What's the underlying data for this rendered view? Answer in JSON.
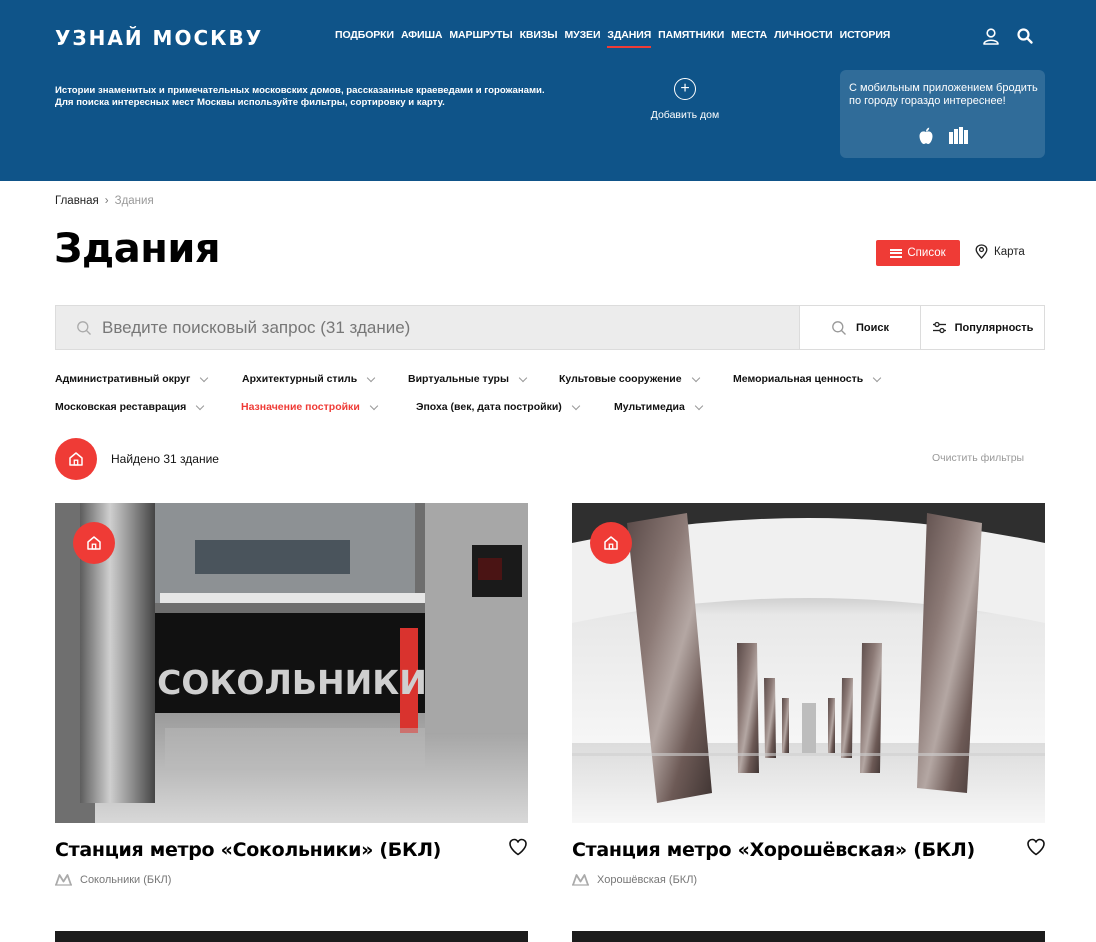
{
  "header": {
    "logo": "УЗНАЙ МОСКВУ",
    "nav": [
      "ПОДБОРКИ",
      "АФИША",
      "МАРШРУТЫ",
      "КВИЗЫ",
      "МУЗЕИ",
      "ЗДАНИЯ",
      "ПАМЯТНИКИ",
      "МЕСТА",
      "ЛИЧНОСТИ",
      "ИСТОРИЯ"
    ],
    "active_nav": "ЗДАНИЯ",
    "description_line1": "Истории знаменитых и примечательных московских домов, рассказанные краеведами и горожанами.",
    "description_line2": "Для поиска интересных мест Москвы используйте фильтры, сортировку и карту.",
    "add_home_label": "Добавить дом",
    "app_promo": "С мобильным приложением бродить по городу гораздо интереснее!",
    "icons": [
      "user-icon",
      "search-icon",
      "apple-icon",
      "app-store-icon",
      "add-icon"
    ]
  },
  "breadcrumb": {
    "home": "Главная",
    "current": "Здания"
  },
  "page_title": "Здания",
  "view_toggle": {
    "list": "Список",
    "map": "Карта"
  },
  "search": {
    "placeholder": "Введите поисковый запрос (31 здание)",
    "button": "Поиск",
    "sort": "Популярность"
  },
  "filters": [
    "Административный округ",
    "Архитектурный стиль",
    "Виртуальные туры",
    "Культовые сооружение",
    "Мемориальная ценность",
    "Московская реставрация",
    "Назначение постройки",
    "Эпоха (век, дата постройки)",
    "Мультимедиа"
  ],
  "active_filter": "Назначение постройки",
  "found": "Найдено 31 здание",
  "clear_filters": "Очистить фильтры",
  "cards": [
    {
      "title": "Станция метро «Сокольники» (БКЛ)",
      "metro": "Сокольники (БКЛ)",
      "sign_text": "СОКОЛЬНИКИ"
    },
    {
      "title": "Станция метро «Хорошёвская» (БКЛ)",
      "metro": "Хорошёвская (БКЛ)"
    }
  ],
  "colors": {
    "brand_blue": "#0f5489",
    "accent_red": "#ef3b36"
  }
}
